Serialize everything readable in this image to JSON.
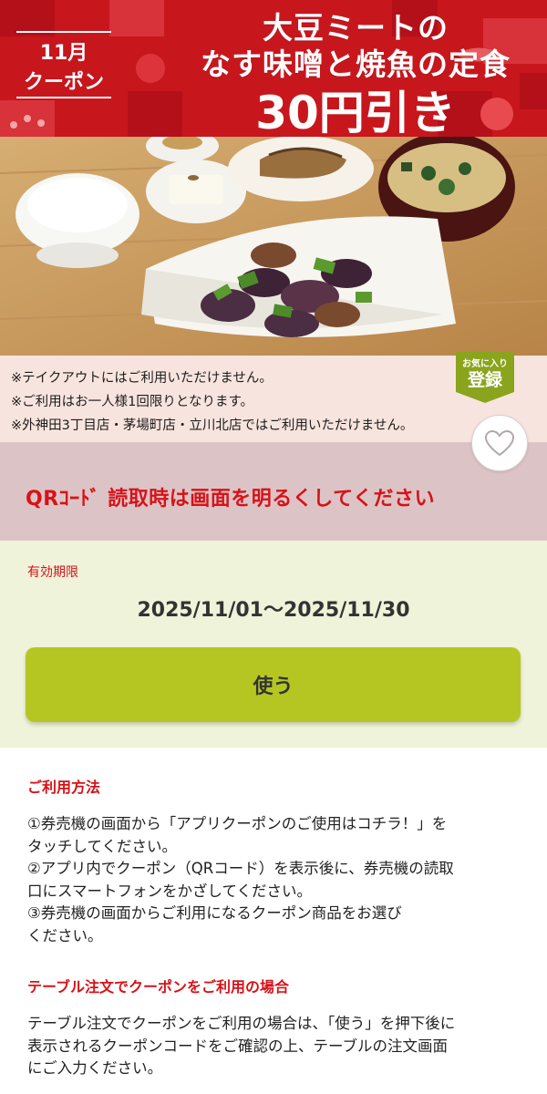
{
  "banner": {
    "month": "11月",
    "label": "クーポン",
    "title_line1": "大豆ミートの",
    "title_line2": "なす味噌と焼魚の定食",
    "title_line3": "30円引き"
  },
  "notes": [
    "※テイクアウトにはご利用いただけません。",
    "※ご利用はお一人様1回限りとなります。",
    "※外神田3丁目店・茅場町店・立川北店ではご利用いただけません。"
  ],
  "favorite_badge": {
    "small": "お気に入り",
    "big": "登録"
  },
  "qr_notice": "QRｺｰﾄﾞ 読取時は画面を明るくしてください",
  "validity": {
    "label": "有効期限",
    "date_range": "2025/11/01～2025/11/30"
  },
  "use_button": "使う",
  "usage": {
    "heading": "ご利用方法",
    "lines": [
      "①券売機の画面から「アプリクーポンのご使用はコチラ！」を",
      "タッチしてください。",
      "②アプリ内でクーポン（QRコード）を表示後に、券売機の読取",
      "口にスマートフォンをかざしてください。",
      "③券売機の画面からご利用になるクーポン商品をお選び",
      "ください。"
    ]
  },
  "table_order": {
    "heading": "テーブル注文でクーポンをご利用の場合",
    "lines": [
      "テーブル注文でクーポンをご利用の場合は、「使う」を押下後に",
      "表示されるクーポンコードをご確認の上、テーブルの注文画面",
      "にご入力ください。"
    ]
  },
  "colors": {
    "brand_red": "#d71218",
    "banner_red": "#c8161d",
    "button_green": "#b5c623",
    "badge_green": "#8aa41d"
  }
}
